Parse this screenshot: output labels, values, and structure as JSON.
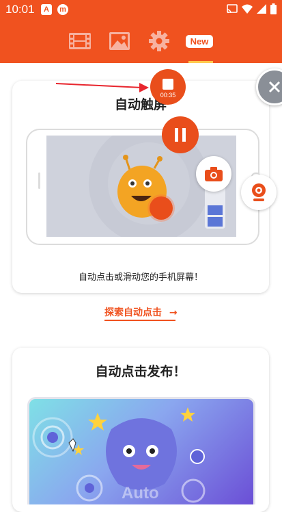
{
  "status_bar": {
    "time": "10:01",
    "app_icon_a": "A",
    "app_icon_m": "m",
    "icons": [
      "cast-icon",
      "wifi-icon",
      "signal-icon",
      "battery-icon"
    ]
  },
  "tabs": [
    {
      "name": "video-tab",
      "icon": "film-icon"
    },
    {
      "name": "screenshot-tab",
      "icon": "image-icon"
    },
    {
      "name": "settings-tab",
      "icon": "gear-icon"
    },
    {
      "name": "new-tab",
      "label": "New",
      "selected": true
    }
  ],
  "card1": {
    "title": "自动触屏",
    "caption": "自动点击或滑动您的手机屏幕！"
  },
  "explore_link": {
    "label": "探索自动点击",
    "arrow": "→"
  },
  "card2": {
    "title": "自动点击发布！",
    "illustration_text": "Auto"
  },
  "floating": {
    "timer": "00:35"
  },
  "colors": {
    "brand": "#f0521f",
    "tab_indicator": "#ffc94d",
    "screen_bg": "#cfd2dc"
  }
}
